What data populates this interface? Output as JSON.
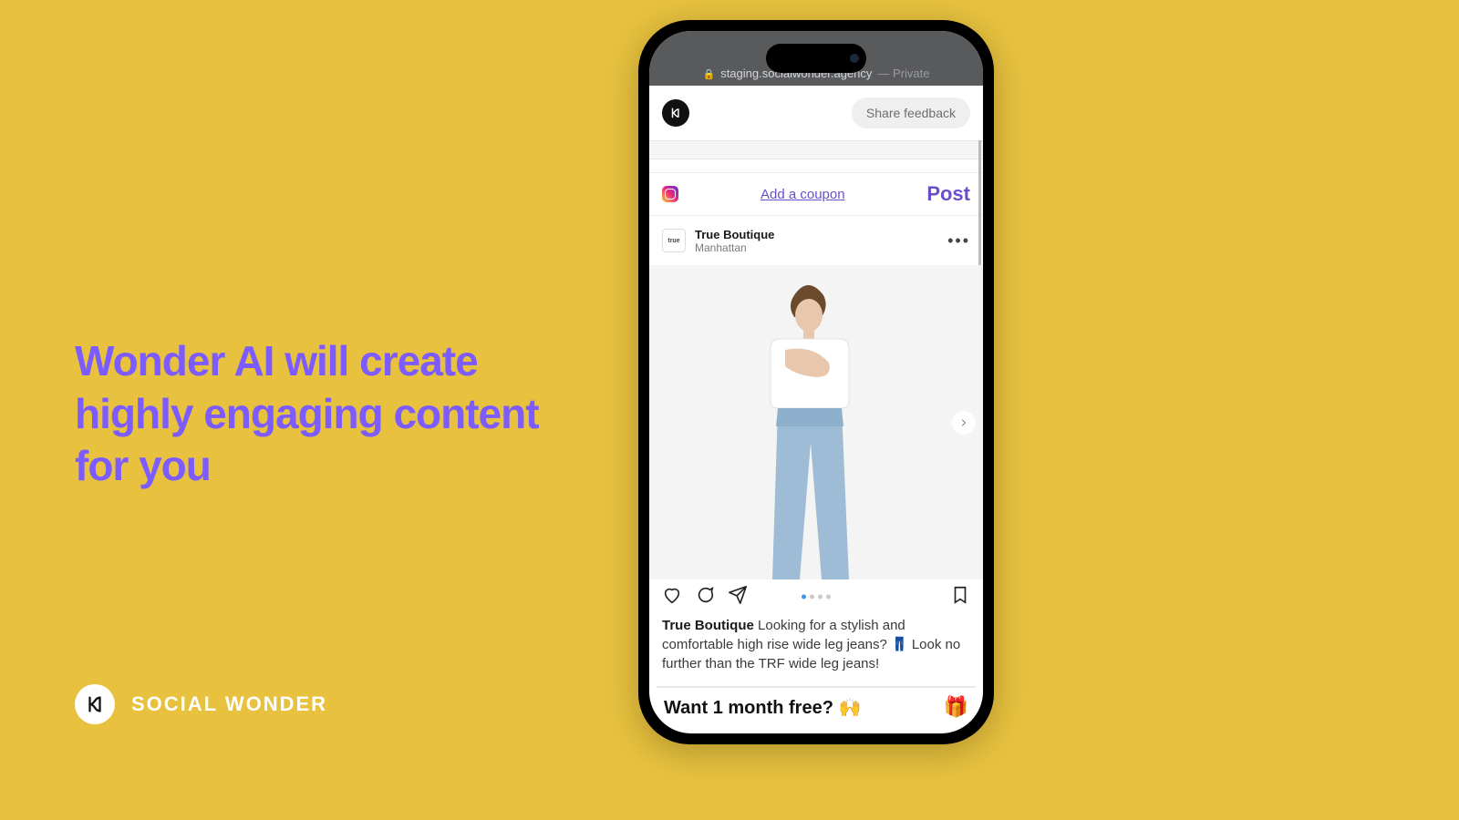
{
  "headline": "Wonder AI will create highly engaging content for you",
  "brand_wordmark": "SOCIAL WONDER",
  "browser": {
    "url": "staging.socialwonder.agency",
    "suffix": " — Private"
  },
  "app": {
    "share_label": "Share feedback"
  },
  "coupon_row": {
    "add_coupon": "Add a coupon",
    "post": "Post"
  },
  "post": {
    "avatar_text": "true",
    "name": "True Boutique",
    "location": "Manhattan",
    "caption_name": "True Boutique",
    "caption_body": "Looking for a stylish and comfortable high rise wide leg jeans? 👖 Look no further than the TRF wide leg jeans!"
  },
  "promo": {
    "text": "Want 1 month free? 🙌"
  }
}
